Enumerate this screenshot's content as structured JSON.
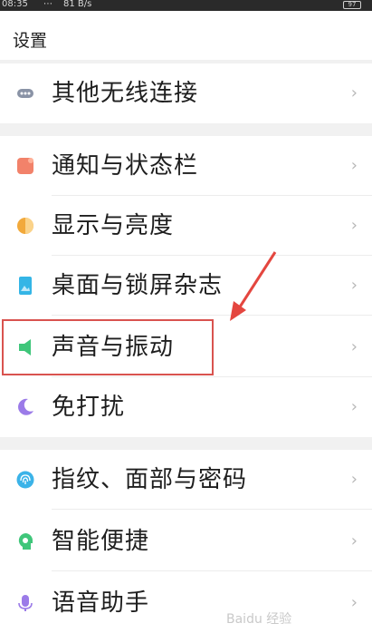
{
  "status_bar": {
    "time": "08:35",
    "dots": "⋯",
    "speed": "81 B/s",
    "battery": "97"
  },
  "title": "设置",
  "items": [
    {
      "label": "其他无线连接",
      "icon": "more-dots-icon",
      "color": "#8a93a6"
    },
    {
      "label": "通知与状态栏",
      "icon": "notification-icon",
      "color": "#f2826a"
    },
    {
      "label": "显示与亮度",
      "icon": "brightness-icon",
      "color": "#f2a93b"
    },
    {
      "label": "桌面与锁屏杂志",
      "icon": "wallpaper-icon",
      "color": "#34b5e6"
    },
    {
      "label": "声音与振动",
      "icon": "speaker-icon",
      "color": "#3fc67a"
    },
    {
      "label": "免打扰",
      "icon": "moon-icon",
      "color": "#9b7be8"
    },
    {
      "label": "指纹、面部与密码",
      "icon": "fingerprint-icon",
      "color": "#3bb3e8"
    },
    {
      "label": "智能便捷",
      "icon": "smart-head-icon",
      "color": "#3fc67a"
    },
    {
      "label": "语音助手",
      "icon": "microphone-icon",
      "color": "#9b7be8"
    }
  ],
  "chevron": "›",
  "watermark": "Baidu 经验"
}
